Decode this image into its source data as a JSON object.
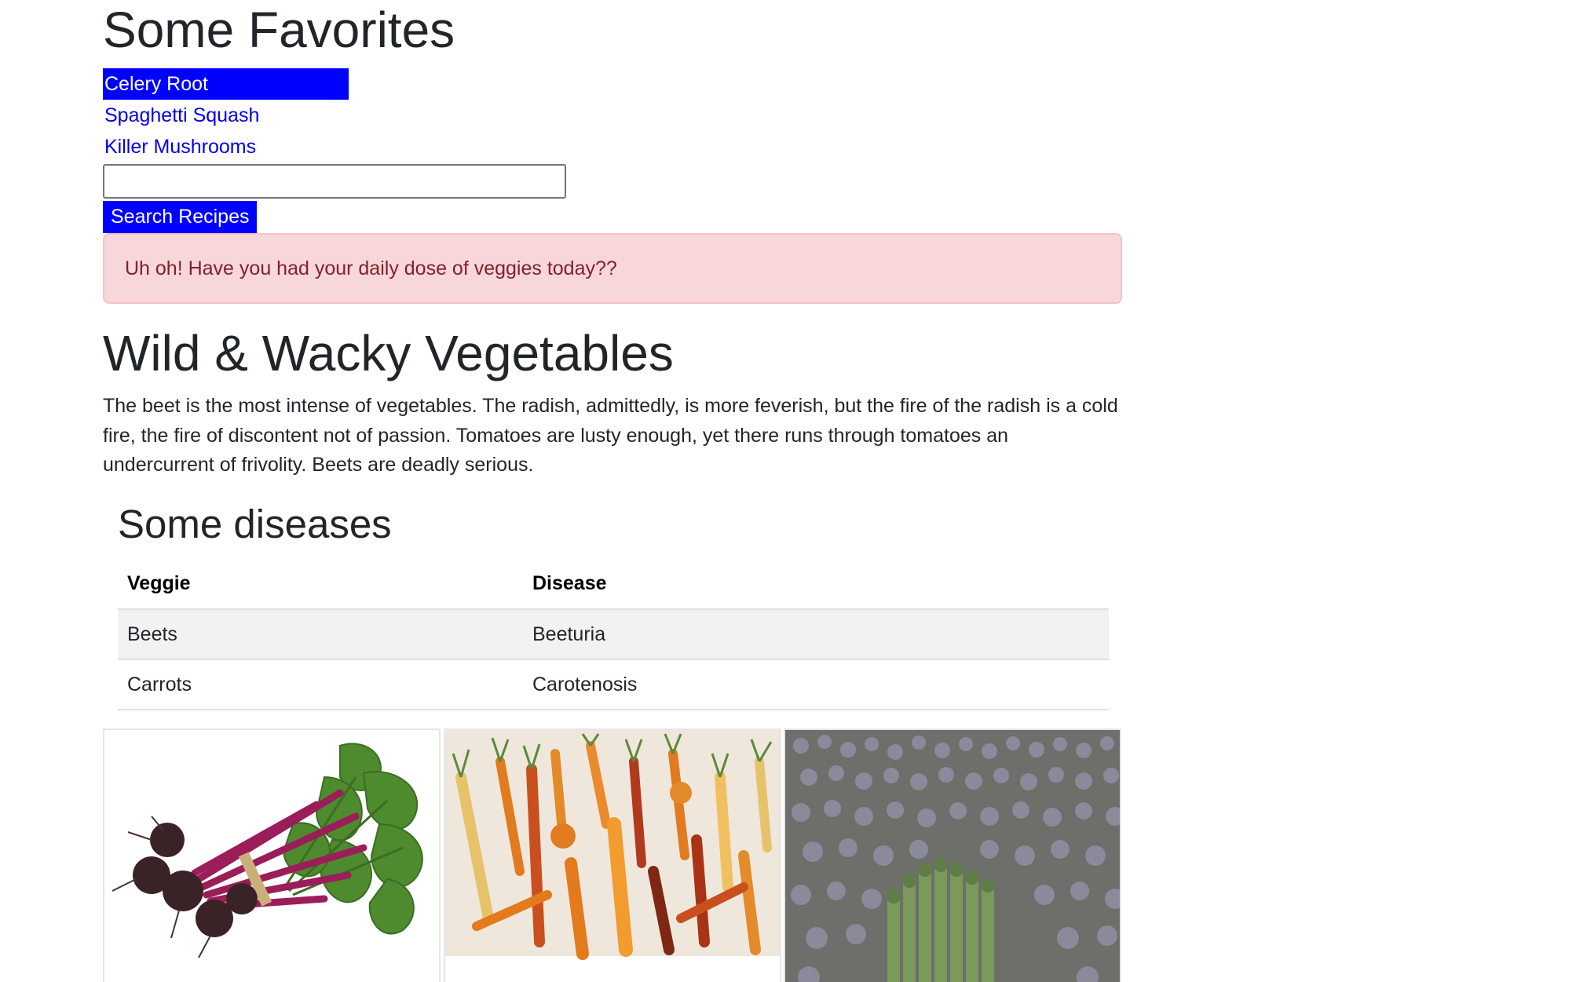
{
  "favorites": {
    "title": "Some Favorites",
    "items": [
      {
        "label": "Celery Root",
        "selected": true
      },
      {
        "label": "Spaghetti Squash",
        "selected": false
      },
      {
        "label": "Killer Mushrooms",
        "selected": false
      }
    ]
  },
  "search": {
    "value": "",
    "placeholder": "",
    "button_label": "Search Recipes"
  },
  "alert": {
    "text": "Uh oh! Have you had your daily dose of veggies today??"
  },
  "article": {
    "title": "Wild & Wacky Vegetables",
    "body": "The beet is the most intense of vegetables. The radish, admittedly, is more feverish, but the fire of the radish is a cold fire, the fire of discontent not of passion. Tomatoes are lusty enough, yet there runs through tomatoes an undercurrent of frivolity. Beets are deadly serious."
  },
  "diseases": {
    "title": "Some diseases",
    "columns": [
      "Veggie",
      "Disease"
    ],
    "rows": [
      [
        "Beets",
        "Beeturia"
      ],
      [
        "Carrots",
        "Carotenosis"
      ]
    ]
  },
  "gallery": {
    "images": [
      "beets-photo",
      "carrots-photo",
      "asparagus-photo"
    ]
  },
  "colors": {
    "selected_bg": "#0000ff",
    "link": "#0000ee",
    "alert_bg": "#f8d7da",
    "alert_text": "#842029"
  }
}
